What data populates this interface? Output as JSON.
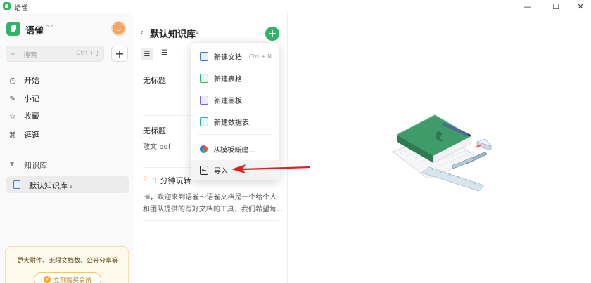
{
  "window": {
    "title": "语雀",
    "minimize": "—",
    "maximize": "☐",
    "close": "✕"
  },
  "sidebar": {
    "brand": "语雀",
    "search": {
      "placeholder": "搜索",
      "shortcut": "Ctrl + J"
    },
    "add_label": "+",
    "nav": [
      {
        "label": "开始",
        "icon": "clock-icon",
        "glyph": "◷"
      },
      {
        "label": "小记",
        "icon": "feather-icon",
        "glyph": "✎"
      },
      {
        "label": "收藏",
        "icon": "star-icon",
        "glyph": "☆"
      },
      {
        "label": "逛逛",
        "icon": "grid-icon",
        "glyph": "⌘"
      }
    ],
    "section_title": "知识库",
    "knowledge_base": "默认知识库",
    "promo": {
      "text": "更大附件、无限文档数、公开分享等",
      "button": "立刻购买会员"
    }
  },
  "doclist": {
    "title": "默认知识库",
    "create_label": "+",
    "docs": [
      {
        "title": "无标题"
      },
      {
        "title": "无标题"
      },
      {
        "title": "散文.pdf"
      }
    ],
    "tip": {
      "title": "1 分钟玩转",
      "line1": "Hi，欢迎来到语雀～语雀文档是一个给个人",
      "line2": "和团队提供的写好文档的工具，我们希望每..."
    }
  },
  "menu": {
    "items": [
      {
        "label": "新建文档",
        "shortcut": "Ctrl + N",
        "icon": "doc-icon",
        "color": "#3b7cd9"
      },
      {
        "label": "新建表格",
        "shortcut": "",
        "icon": "sheet-icon",
        "color": "#2fb56a"
      },
      {
        "label": "新建画板",
        "shortcut": "",
        "icon": "board-icon",
        "color": "#7b61d9"
      },
      {
        "label": "新建数据表",
        "shortcut": "",
        "icon": "datatable-icon",
        "color": "#2fa7b5"
      },
      {
        "label": "从模板新建...",
        "shortcut": "",
        "icon": "template-icon",
        "color": "#e8563f"
      },
      {
        "label": "导入...",
        "shortcut": "",
        "icon": "import-icon",
        "color": "#262626"
      }
    ]
  },
  "colors": {
    "accent": "#2fb56a",
    "annotation_arrow": "#e02020"
  }
}
